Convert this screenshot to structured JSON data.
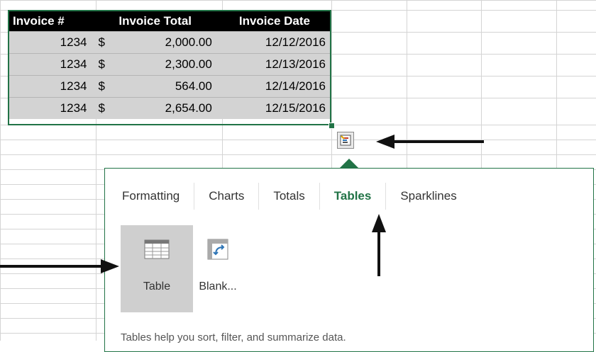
{
  "table": {
    "headers": [
      "Invoice #",
      "Invoice Total",
      "Invoice Date"
    ],
    "rows": [
      {
        "invoice": "1234",
        "currency": "$",
        "total": "2,000.00",
        "date": "12/12/2016"
      },
      {
        "invoice": "1234",
        "currency": "$",
        "total": "2,300.00",
        "date": "12/13/2016"
      },
      {
        "invoice": "1234",
        "currency": "$",
        "total": "564.00",
        "date": "12/14/2016"
      },
      {
        "invoice": "1234",
        "currency": "$",
        "total": "2,654.00",
        "date": "12/15/2016"
      }
    ]
  },
  "quick_analysis": {
    "tabs": [
      {
        "label": "Formatting",
        "active": false
      },
      {
        "label": "Charts",
        "active": false
      },
      {
        "label": "Totals",
        "active": false
      },
      {
        "label": "Tables",
        "active": true
      },
      {
        "label": "Sparklines",
        "active": false
      }
    ],
    "options": [
      {
        "label": "Table",
        "icon": "table-icon",
        "selected": true
      },
      {
        "label": "Blank...",
        "icon": "pivot-table-icon",
        "selected": false
      }
    ],
    "description": "Tables help you sort, filter, and summarize data."
  },
  "colors": {
    "accent_green": "#217346",
    "header_bg": "#000000",
    "cell_bg": "#d3d3d3"
  }
}
